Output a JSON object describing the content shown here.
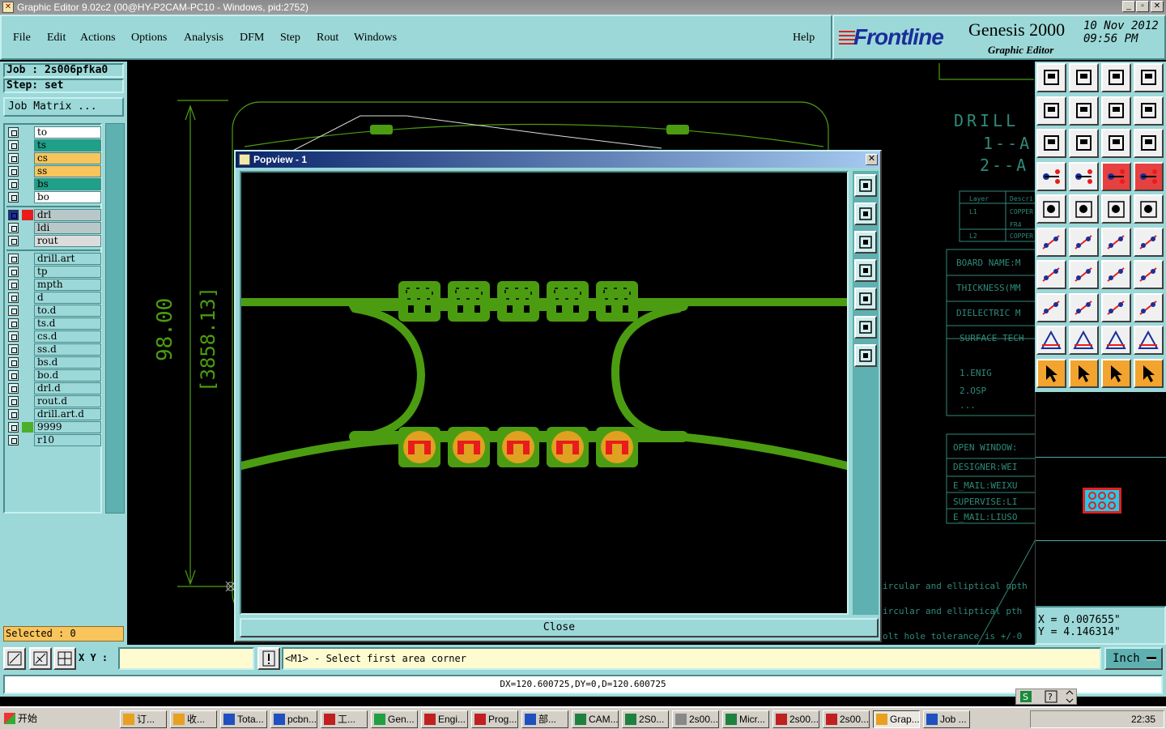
{
  "window": {
    "title": "Graphic Editor 9.02c2 (00@HY-P2CAM-PC10 - Windows, pid:2752)"
  },
  "menu": {
    "items": [
      "File",
      "Edit",
      "Actions",
      "Options",
      "Analysis",
      "DFM",
      "Step",
      "Rout",
      "Windows"
    ],
    "help": "Help"
  },
  "brand": {
    "logo": "Frontline",
    "product": "Genesis 2000",
    "subtitle": "Graphic Editor",
    "date": "10 Nov 2012",
    "time": "09:56 PM"
  },
  "job": {
    "job_label": "Job : 2s006pfka0",
    "step_label": "Step: set",
    "matrix_button": "Job Matrix ..."
  },
  "layers": [
    {
      "name": "to",
      "color": "#ffffff"
    },
    {
      "name": "ts",
      "color": "#1fa088"
    },
    {
      "name": "cs",
      "color": "#f8c45c"
    },
    {
      "name": "ss",
      "color": "#f8c45c"
    },
    {
      "name": "bs",
      "color": "#1fa088"
    },
    {
      "name": "bo",
      "color": "#ffffff"
    },
    {
      "name": "drl",
      "color": "#b8c8c8",
      "work": true
    },
    {
      "name": "ldi",
      "color": "#b8c8c8"
    },
    {
      "name": "rout",
      "color": "#dcdcdc"
    },
    {
      "name": "drill.art",
      "color": "#9cd8d8"
    },
    {
      "name": "tp",
      "color": "#9cd8d8"
    },
    {
      "name": "mpth",
      "color": "#9cd8d8"
    },
    {
      "name": "d",
      "color": "#9cd8d8"
    },
    {
      "name": "to.d",
      "color": "#9cd8d8"
    },
    {
      "name": "ts.d",
      "color": "#9cd8d8"
    },
    {
      "name": "cs.d",
      "color": "#9cd8d8"
    },
    {
      "name": "ss.d",
      "color": "#9cd8d8"
    },
    {
      "name": "bs.d",
      "color": "#9cd8d8"
    },
    {
      "name": "bo.d",
      "color": "#9cd8d8"
    },
    {
      "name": "drl.d",
      "color": "#9cd8d8"
    },
    {
      "name": "rout.d",
      "color": "#9cd8d8"
    },
    {
      "name": "drill.art.d",
      "color": "#9cd8d8"
    },
    {
      "name": "9999",
      "color": "#9cd8d8",
      "display": "#4caf2a"
    },
    {
      "name": "r10",
      "color": "#9cd8d8"
    }
  ],
  "selected": "Selected : 0",
  "canvas": {
    "dimension_main": "98.00",
    "dimension_inch": "[3858.13]",
    "drill_title": "DRILL",
    "drill_lines": [
      "1--A",
      "2--A"
    ],
    "table_headers": [
      "Layer",
      "Descri"
    ],
    "table_rows": [
      [
        "L1",
        "COPPER"
      ],
      [
        "",
        "FR4"
      ],
      [
        "L2",
        "COPPER"
      ]
    ],
    "info_labels": [
      "BOARD NAME:M",
      "THICKNESS(MM",
      "DIELECTRIC M",
      "SURFACE TECH"
    ],
    "finish_items": [
      "1.ENIG",
      "2.OSP",
      "..."
    ],
    "contact_labels": [
      "OPEN WINDOW:",
      "DESIGNER:WEI",
      "E_MAIL:WEIXU",
      "SUPERVISE:LI",
      "E_MAIL:LIUSO"
    ],
    "notes": [
      "ircular and elliptical npth",
      "ircular and elliptical pth",
      "olt hole tolerance is +/-0"
    ]
  },
  "popview": {
    "title": "Popview - 1",
    "close_label": "Close",
    "trace_color": "#4c9c12",
    "pad_color": "#e0a020",
    "mark_color": "#e81c1c"
  },
  "coords": {
    "x": "X = 0.007655\"",
    "y": "Y = 4.146314\""
  },
  "command": {
    "xy_label": "X Y :",
    "xy_value": "",
    "prompt": "<M1> - Select first area corner",
    "units": "Inch"
  },
  "status": {
    "text": "DX=120.600725,DY=0,D=120.600725"
  },
  "taskbar": {
    "start": "开始",
    "items": [
      "订...",
      "收...",
      "Tota...",
      "pcbn...",
      "工...",
      "Gen...",
      "Engi...",
      "Prog...",
      "部...",
      "CAM...",
      "2S0...",
      "2s00...",
      "Micr...",
      "2s00...",
      "2s00...",
      "Grap...",
      "Job ..."
    ],
    "active": "Grap...",
    "clock": "22:35"
  }
}
